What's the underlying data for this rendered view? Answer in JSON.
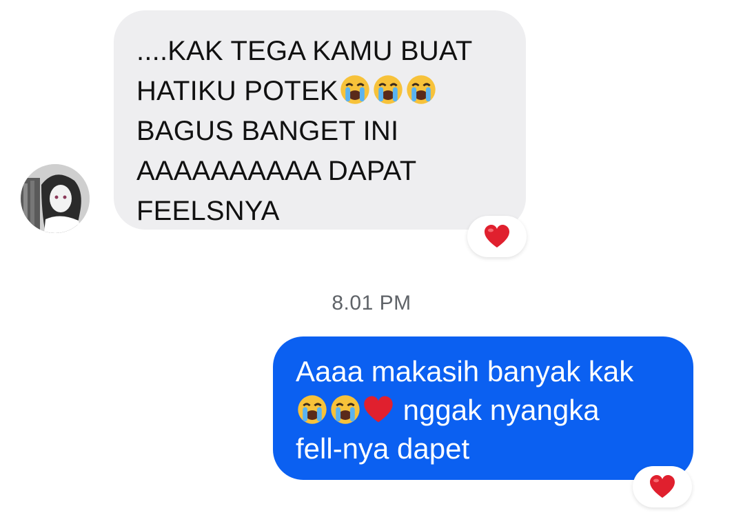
{
  "chat": {
    "incoming": {
      "lines": [
        "....KAK TEGA KAMU BUAT",
        "HATIKU POTEK",
        "BAGUS BANGET INI",
        "AAAAAAAAAA DAPAT",
        "FEELSNYA"
      ],
      "inline_emojis_line2": [
        "loudly-crying-face-icon",
        "loudly-crying-face-icon",
        "loudly-crying-face-icon"
      ],
      "reaction": "red-heart-icon"
    },
    "timestamp": "8.01 PM",
    "outgoing": {
      "lines": [
        "Aaaa makasih banyak kak",
        "nggak nyangka",
        "fell-nya dapet"
      ],
      "inline_emojis_line2": [
        "loudly-crying-face-icon",
        "loudly-crying-face-icon",
        "red-heart-icon"
      ],
      "reaction": "red-heart-icon"
    }
  },
  "colors": {
    "incoming_bubble": "#eeeef0",
    "outgoing_bubble": "#0b60f1",
    "timestamp_text": "#5f6368",
    "heart": "#e0202e"
  }
}
